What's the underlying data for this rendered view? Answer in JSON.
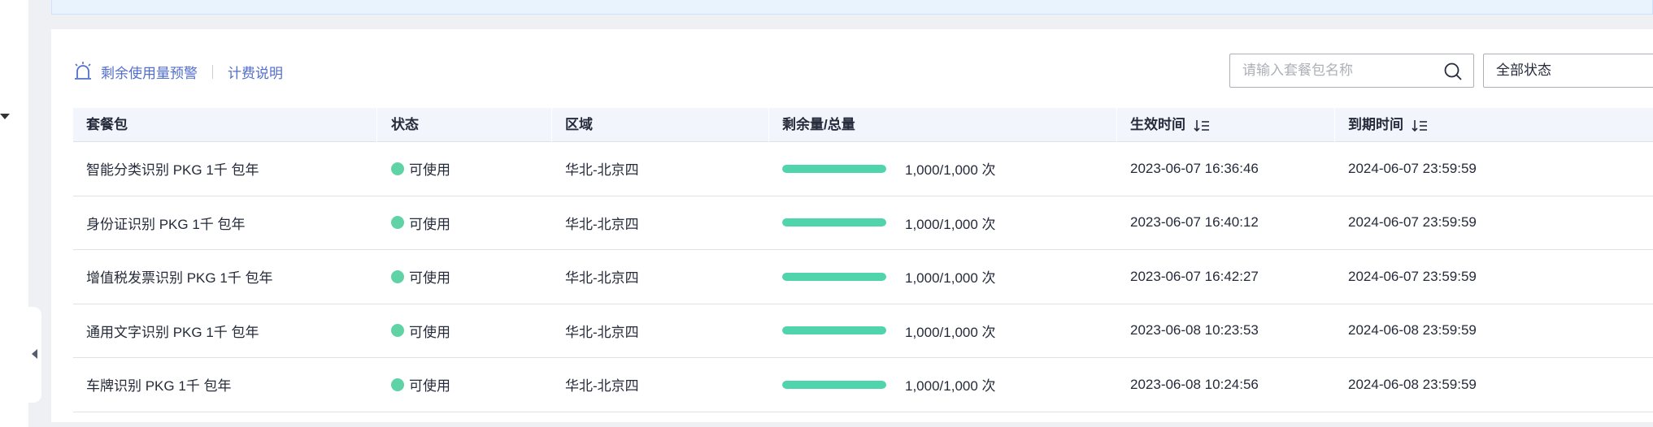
{
  "toolbar": {
    "usage_alert_label": "剩余使用量预警",
    "billing_label": "计费说明"
  },
  "search": {
    "placeholder": "请输入套餐包名称"
  },
  "filter": {
    "status_selected": "全部状态"
  },
  "table": {
    "columns": [
      "套餐包",
      "状态",
      "区域",
      "剩余量/总量",
      "生效时间",
      "到期时间"
    ],
    "rows": [
      {
        "package": "智能分类识别 PKG 1千 包年",
        "status": "可使用",
        "region": "华北-北京四",
        "quota": "1,000/1,000 次",
        "quota_ratio": 1.0,
        "start": "2023-06-07 16:36:46",
        "end": "2024-06-07 23:59:59"
      },
      {
        "package": "身份证识别 PKG 1千 包年",
        "status": "可使用",
        "region": "华北-北京四",
        "quota": "1,000/1,000 次",
        "quota_ratio": 1.0,
        "start": "2023-06-07 16:40:12",
        "end": "2024-06-07 23:59:59"
      },
      {
        "package": "增值税发票识别 PKG 1千 包年",
        "status": "可使用",
        "region": "华北-北京四",
        "quota": "1,000/1,000 次",
        "quota_ratio": 1.0,
        "start": "2023-06-07 16:42:27",
        "end": "2024-06-07 23:59:59"
      },
      {
        "package": "通用文字识别 PKG 1千 包年",
        "status": "可使用",
        "region": "华北-北京四",
        "quota": "1,000/1,000 次",
        "quota_ratio": 1.0,
        "start": "2023-06-08 10:23:53",
        "end": "2024-06-08 23:59:59"
      },
      {
        "package": "车牌识别 PKG 1千 包年",
        "status": "可使用",
        "region": "华北-北京四",
        "quota": "1,000/1,000 次",
        "quota_ratio": 1.0,
        "start": "2023-06-08 10:24:56",
        "end": "2024-06-08 23:59:59"
      }
    ]
  },
  "colors": {
    "link": "#526ecc",
    "status_available": "#5fd3a6",
    "progress": "#50d4ab",
    "header_bg": "#f2f5fc"
  }
}
